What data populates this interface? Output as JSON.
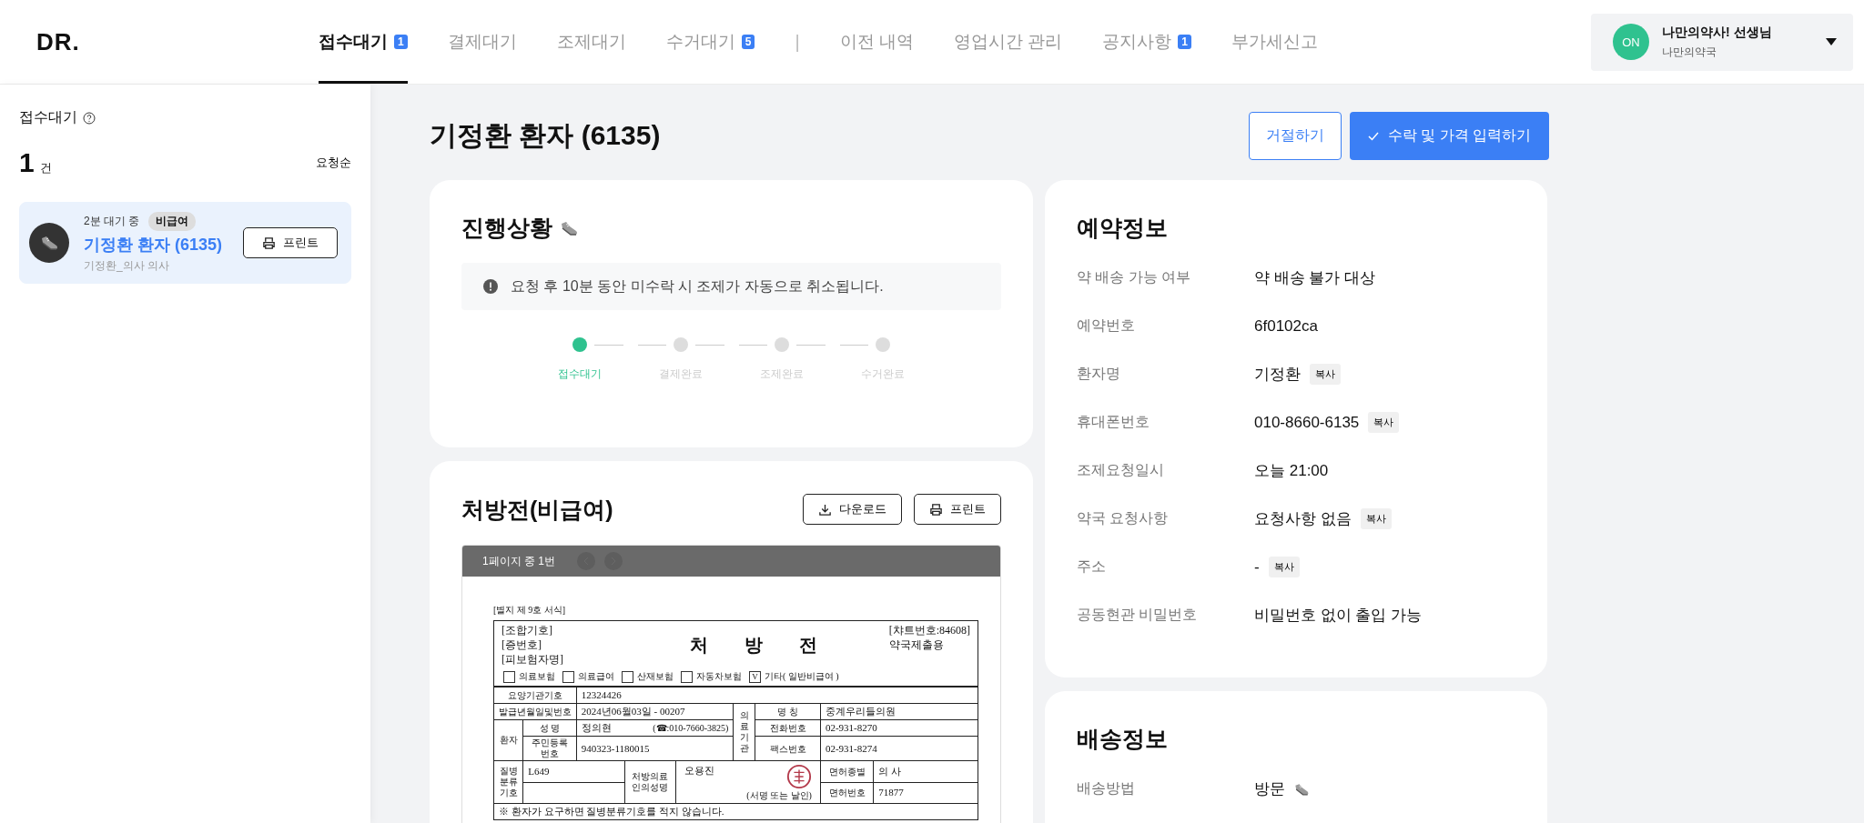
{
  "header": {
    "logo": "DR.",
    "tabs": [
      {
        "label": "접수대기",
        "badge": "1",
        "selected": true
      },
      {
        "label": "결제대기",
        "selected": false
      },
      {
        "label": "조제대기",
        "selected": false
      },
      {
        "label": "수거대기",
        "badge": "5",
        "selected": false
      },
      {
        "kind": "separator",
        "label": "|"
      },
      {
        "label": "이전 내역",
        "selected": false
      },
      {
        "label": "영업시간 관리",
        "selected": false
      },
      {
        "label": "공지사항",
        "badge": "1",
        "selected": false
      },
      {
        "label": "부가세신고",
        "selected": false
      }
    ],
    "user": {
      "avatar": "ON",
      "name": "나만의약사! 선생님",
      "pharmacy": "나만의약국"
    }
  },
  "sidebar": {
    "title": "접수대기",
    "count": "1",
    "count_unit": "건",
    "sort": "요청순",
    "requests": [
      {
        "wait": "2분 대기 중",
        "tag": "비급여",
        "patient": "기정환 환자 (6135)",
        "doctor": "기정환_의사 의사",
        "print": "프린트",
        "selected": true
      }
    ]
  },
  "main": {
    "title": "기정환 환자 (6135)",
    "reject": "거절하기",
    "accept": "수락 및 가격 입력하기",
    "progress": {
      "title": "진행상황",
      "notice": "요청 후 10분 동안 미수락 시 조제가 자동으로 취소됩니다.",
      "steps": [
        {
          "label": "접수대기",
          "selected": true
        },
        {
          "label": "결제완료",
          "selected": false
        },
        {
          "label": "조제완료",
          "selected": false
        },
        {
          "label": "수거완료",
          "selected": false
        }
      ]
    },
    "prescription": {
      "title": "처방전(비급여)",
      "download": "다운로드",
      "print": "프린트",
      "page": "1페이지 중 1번",
      "document": {
        "form_no": "[별지 제 9호 서식]",
        "left_codes": [
          "[조합기호]",
          "[증번호]",
          "[피보험자명]"
        ],
        "title_chars": [
          "처",
          "방",
          "전"
        ],
        "chart_no": "[챠트번호:84608]",
        "copy": "약국제출용",
        "insurance": [
          {
            "label": "의료보험",
            "checked": false
          },
          {
            "label": "의료급여",
            "checked": false
          },
          {
            "label": "산재보험",
            "checked": false
          },
          {
            "label": "자동차보험",
            "checked": false
          },
          {
            "label": "기타( 일반비급여 )",
            "checked": true
          }
        ],
        "check_mark": "V",
        "facility_code_label": "요양기관기호",
        "facility_code": "12324426",
        "issue_label": "발급년월일및번호",
        "issue": "2024년06월03일  -  00207",
        "institution_label": "의료기관",
        "name_label": "명    칭",
        "institution": "중계우리들의원",
        "patient_label": "환자",
        "patient_name_label": "성    명",
        "patient_name": "정의현",
        "patient_phone": "(☎:010-7660-3825)",
        "phone_label": "전화번호",
        "phone": "02-931-8270",
        "id_label": "주민등록번호",
        "id": "940323-1180015",
        "fax_label": "팩스번호",
        "fax": "02-931-8274",
        "disease_label": "질병분류기호",
        "disease": "L649",
        "doctor_label": "처방의료인의성명",
        "doctor": "오용진",
        "sign_note": "(서명 또는 날인)",
        "license_type_label": "면허종별",
        "license_type": "의    사",
        "license_no_label": "면허번호",
        "license_no": "71877",
        "note": "※ 환자가 요구하면 질병분류기호를 적지 않습니다."
      }
    },
    "reservation": {
      "title": "예약정보",
      "rows": [
        {
          "label": "약 배송 가능 여부",
          "value": "약 배송 불가 대상"
        },
        {
          "label": "예약번호",
          "value": "6f0102ca"
        },
        {
          "label": "환자명",
          "value": "기정환",
          "copy": "복사"
        },
        {
          "label": "휴대폰번호",
          "value": "010-8660-6135",
          "copy": "복사"
        },
        {
          "label": "조제요청일시",
          "value": "오늘 21:00"
        },
        {
          "label": "약국 요청사항",
          "value": "요청사항 없음",
          "copy": "복사"
        },
        {
          "label": "주소",
          "value": "-",
          "copy": "복사"
        },
        {
          "label": "공동현관 비밀번호",
          "value": "비밀번호 없이 출입 가능"
        }
      ]
    },
    "delivery": {
      "title": "배송정보",
      "rows": [
        {
          "label": "배송방법",
          "value": "방문"
        }
      ]
    }
  }
}
